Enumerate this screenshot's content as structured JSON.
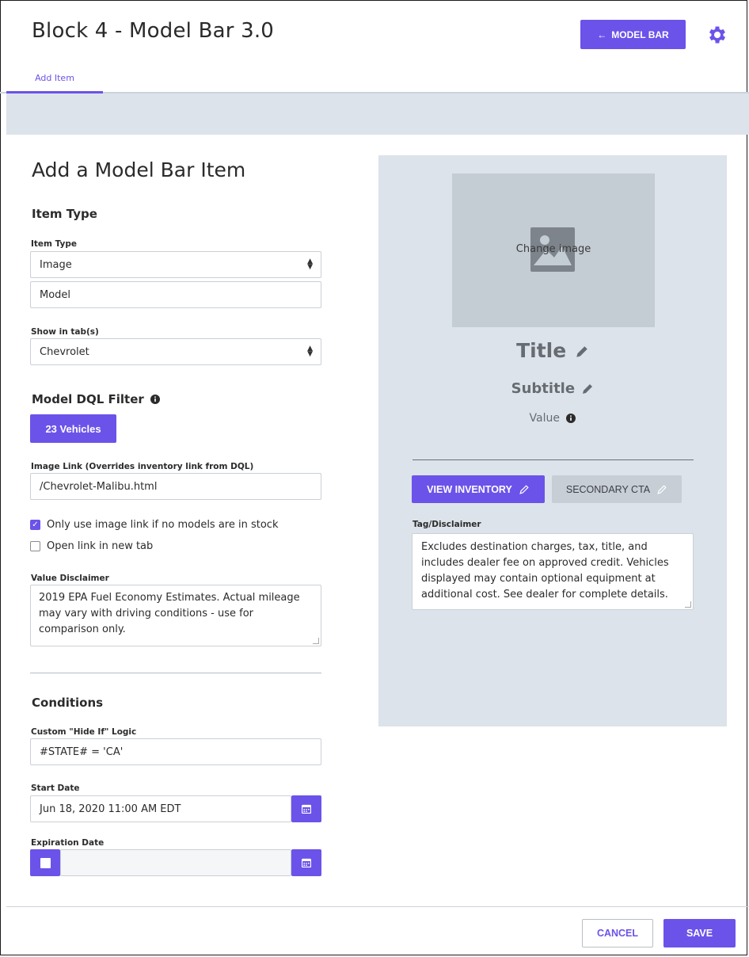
{
  "header": {
    "title": "Block 4 - Model Bar 3.0",
    "back_button": "MODEL BAR",
    "back_arrow": "←",
    "tabs": [
      {
        "label": "Add Item"
      }
    ]
  },
  "form": {
    "heading": "Add a Model Bar Item",
    "item_type_section": "Item Type",
    "item_type_label": "Item Type",
    "item_type_value": "Image",
    "item_subtype_value": "Model",
    "show_in_tabs_label": "Show in tab(s)",
    "show_in_tabs_value": "Chevrolet",
    "dql_section": "Model DQL Filter",
    "vehicles_button": "23 Vehicles",
    "image_link_label": "Image Link (Overrides inventory link from DQL)",
    "image_link_value": "/Chevrolet-Malibu.html",
    "checkboxes": [
      {
        "label": "Only use image link if no models are in stock",
        "checked": true
      },
      {
        "label": "Open link in new tab",
        "checked": false
      }
    ],
    "value_disclaimer_label": "Value Disclaimer",
    "value_disclaimer_value": "2019 EPA Fuel Economy Estimates. Actual mileage may vary with driving conditions - use for comparison only.",
    "conditions_section": "Conditions",
    "hide_if_label": "Custom \"Hide If\" Logic",
    "hide_if_value": "#STATE# = 'CA'",
    "start_date_label": "Start Date",
    "start_date_value": "Jun 18, 2020 11:00 AM EDT",
    "expiration_date_label": "Expiration Date",
    "expiration_date_value": ""
  },
  "preview": {
    "change_image": "Change image",
    "title": "Title",
    "subtitle": "Subtitle",
    "value": "Value",
    "cta_primary": "VIEW INVENTORY",
    "cta_secondary": "SECONDARY CTA",
    "tag_label": "Tag/Disclaimer",
    "tag_value": "Excludes destination charges, tax, title, and includes dealer fee on approved credit. Vehicles displayed may contain optional equipment at additional cost. See dealer for complete details."
  },
  "footer": {
    "cancel": "CANCEL",
    "save": "SAVE"
  },
  "colors": {
    "accent": "#6b53ea",
    "panel": "#dde3ea"
  }
}
